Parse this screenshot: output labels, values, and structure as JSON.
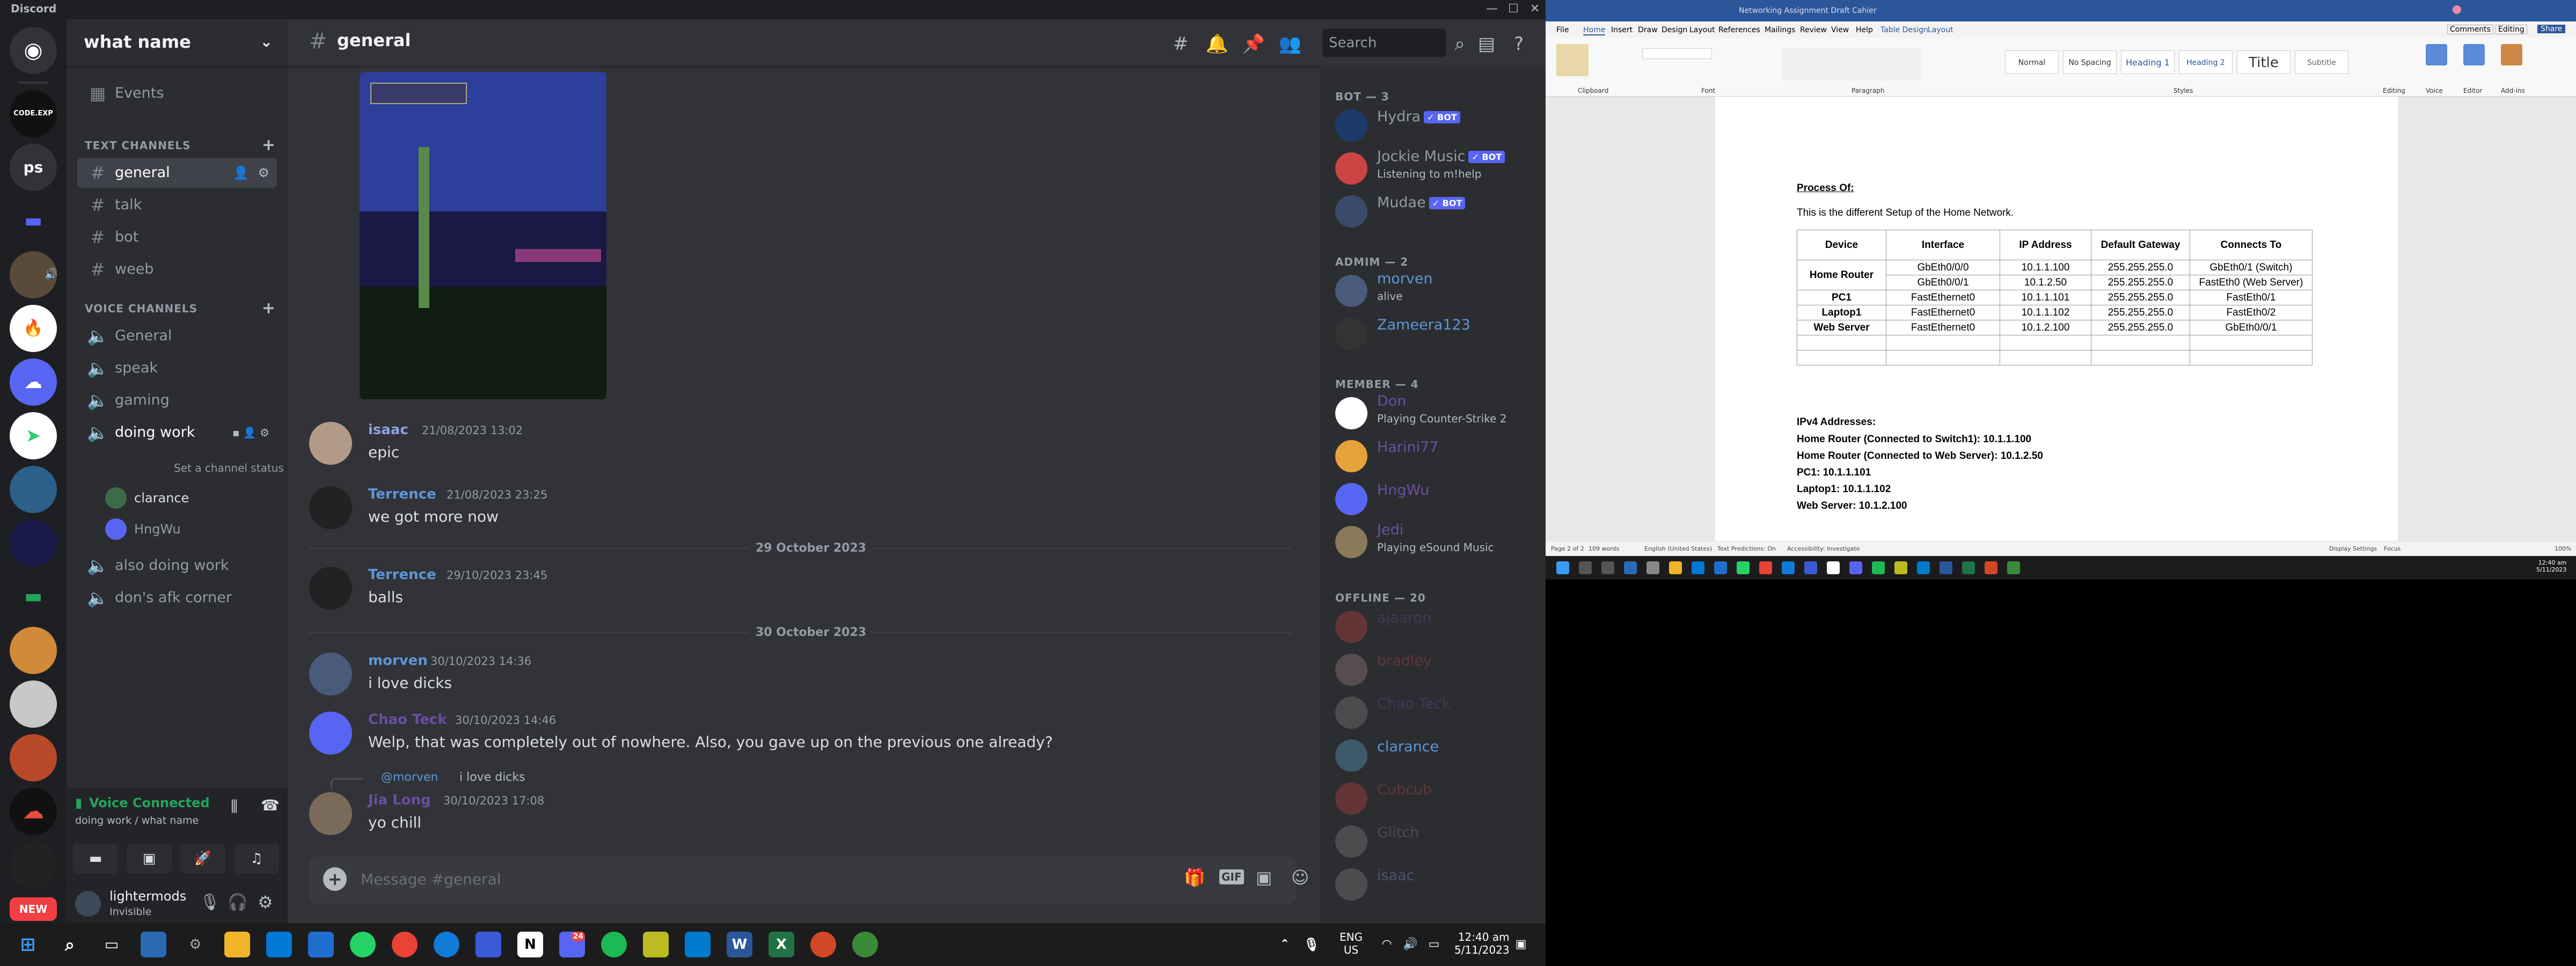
{
  "discord": {
    "app_title": "Discord",
    "guild_labels": {
      "codexp": "CODE.EXP",
      "ps": "ps",
      "new": "NEW"
    },
    "server_name": "what name",
    "events": "Events",
    "text_category": "TEXT CHANNELS",
    "text_channels": [
      "general",
      "talk",
      "bot",
      "weeb"
    ],
    "voice_category": "VOICE CHANNELS",
    "voice_channels": [
      "General",
      "speak",
      "gaming",
      "doing work",
      "also doing work",
      "don's afk corner"
    ],
    "channel_status": "Set a channel status",
    "voice_users": [
      "clarance",
      "HngWu"
    ],
    "voice_panel": {
      "status": "Voice Connected",
      "location": "doing work / what name"
    },
    "user": {
      "name": "lightermods",
      "status": "Invisible"
    },
    "chat": {
      "channel": "general",
      "search_placeholder": "Search",
      "composer_placeholder": "Message #general",
      "messages": [
        {
          "author": "isaac",
          "time": "21/08/2023 13:02",
          "text": "epic",
          "color": "#8ea1e1"
        },
        {
          "author": "Terrence",
          "time": "21/08/2023 23:25",
          "text": "we got more now",
          "color": "#5e97d6"
        },
        {
          "author": "Terrence",
          "time": "29/10/2023 23:45",
          "text": "balls",
          "color": "#5e97d6"
        },
        {
          "author": "morven",
          "time": "30/10/2023 14:36",
          "text": "i love dicks",
          "color": "#5e97d6"
        },
        {
          "author": "Chao Teck",
          "time": "30/10/2023 14:46",
          "text": "Welp, that was completely out of nowhere. Also, you gave up on the previous one already?",
          "color": "#6b4fa0"
        },
        {
          "author": "Jia Long",
          "time": "30/10/2023 17:08",
          "text": "yo chill",
          "color": "#6b4fa0",
          "reply_author": "@morven",
          "reply_text": "i love dicks"
        }
      ],
      "dividers": [
        "29 October 2023",
        "30 October 2023"
      ]
    },
    "members": {
      "bot_header": "BOT — 3",
      "bots": [
        {
          "name": "Hydra",
          "status": ""
        },
        {
          "name": "Jockie Music",
          "status": "Listening to m!help"
        },
        {
          "name": "Mudae",
          "status": ""
        }
      ],
      "bot_tag": "✓ BOT",
      "admin_header": "ADMIM — 2",
      "admins": [
        {
          "name": "morven",
          "status": "alive"
        },
        {
          "name": "Zameera123",
          "status": ""
        }
      ],
      "member_header": "MEMBER — 4",
      "members": [
        {
          "name": "Don",
          "status": "Playing Counter-Strike 2"
        },
        {
          "name": "Harini77",
          "status": ""
        },
        {
          "name": "HngWu",
          "status": ""
        },
        {
          "name": "Jedi",
          "status": "Playing eSound Music"
        }
      ],
      "offline_header": "OFFLINE — 20",
      "offline": [
        "ajaaron",
        "bradley",
        "Chao Teck",
        "clarance",
        "Cubcub",
        "Glitch",
        "isaac"
      ]
    }
  },
  "taskbar": {
    "lang": "ENG",
    "region": "US",
    "time": "12:40 am",
    "date": "5/11/2023",
    "discord_badge": "24"
  },
  "word": {
    "title": "Networking Assignment Draft Cahier",
    "tabs": [
      "File",
      "Home",
      "Insert",
      "Draw",
      "Design",
      "Layout",
      "References",
      "Mailings",
      "Review",
      "View",
      "Help",
      "Table Design",
      "Layout"
    ],
    "styles": [
      "Normal",
      "No Spacing",
      "Heading 1",
      "Heading 2",
      "Title",
      "Subtitle"
    ],
    "ribbon_groups": [
      "Clipboard",
      "Font",
      "Paragraph",
      "Styles",
      "Editing",
      "Voice",
      "Editor",
      "Add-ins"
    ],
    "top_buttons": [
      "Comments",
      "Editing",
      "Share"
    ],
    "doc": {
      "heading": "Process Of:",
      "intro": "This is the different Setup of the Home Network.",
      "table_headers": [
        "Device",
        "Interface",
        "IP Address",
        "Default Gateway",
        "Connects To"
      ],
      "rows": [
        [
          "",
          "GbEth0/0/0",
          "10.1.1.100",
          "255.255.255.0",
          "GbEth0/1 (Switch)"
        ],
        [
          "Home Router",
          "GbEth0/0/1",
          "10.1.2.50",
          "255.255.255.0",
          "FastEth0 (Web Server)"
        ],
        [
          "PC1",
          "FastEthernet0",
          "10.1.1.101",
          "255.255.255.0",
          "FastEth0/1"
        ],
        [
          "Laptop1",
          "FastEthernet0",
          "10.1.1.102",
          "255.255.255.0",
          "FastEth0/2"
        ],
        [
          "Web Server",
          "FastEthernet0",
          "10.1.2.100",
          "255.255.255.0",
          "GbEth0/0/1"
        ]
      ],
      "ipv4_header": "IPv4 Addresses:",
      "ipv4_lines": [
        "Home Router (Connected to Switch1):     10.1.1.100",
        "Home Router (Connected to Web Server): 10.1.2.50",
        "PC1:         10.1.1.101",
        "Laptop1: 10.1.1.102",
        "Web Server: 10.1.2.100"
      ]
    },
    "status": {
      "page": "Page 2 of 2",
      "words": "109 words",
      "lang": "English (United States)",
      "predictions": "Text Predictions: On",
      "accessibility": "Accessibility: Investigate",
      "display": "Display Settings",
      "focus": "Focus",
      "zoom": "100%"
    },
    "tray_time": "12:40 am",
    "tray_date": "5/11/2023"
  }
}
